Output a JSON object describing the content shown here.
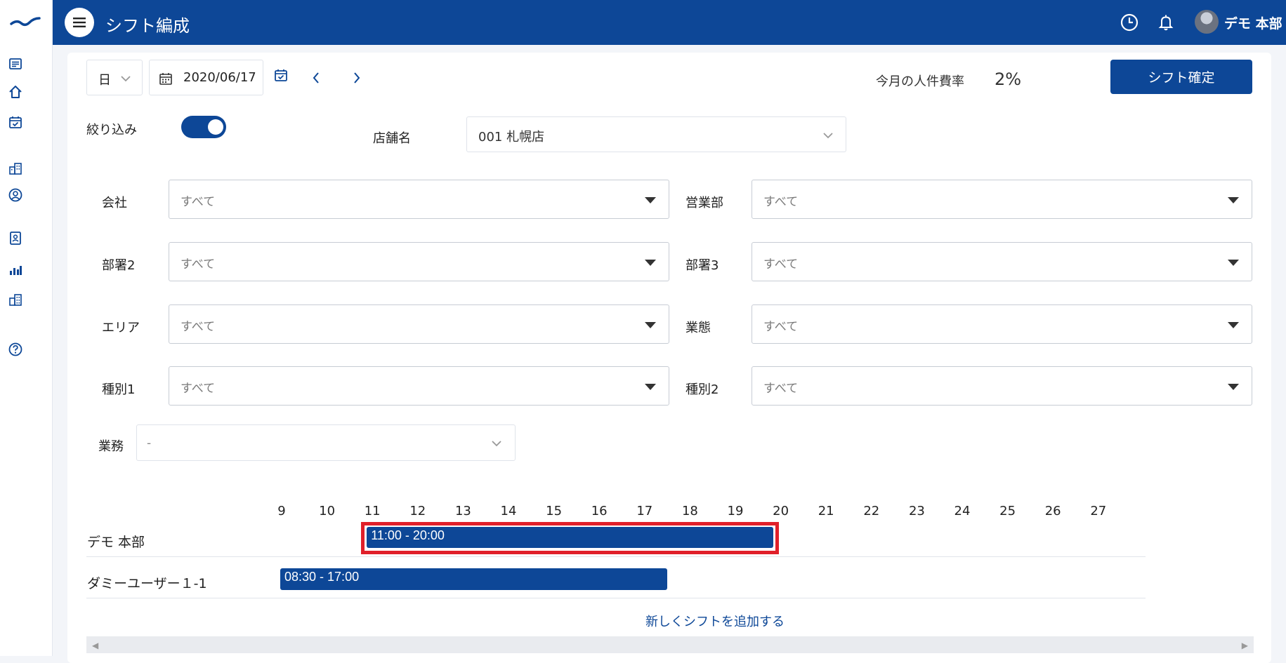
{
  "app": {
    "title": "シフト編成",
    "user": {
      "name": "デモ 本部"
    }
  },
  "toolbar": {
    "view_mode": "日",
    "date": "2020/06/17",
    "labor_cost_label": "今月の人件費率",
    "labor_cost_value": "2%",
    "confirm_button": "シフト確定"
  },
  "filters": {
    "toggle_label": "絞り込み",
    "toggle_on": true,
    "store_label": "店舗名",
    "store_value": "001 札幌店",
    "fields": [
      {
        "label": "会社",
        "value": "すべて"
      },
      {
        "label": "営業部",
        "value": "すべて"
      },
      {
        "label": "部署2",
        "value": "すべて"
      },
      {
        "label": "部署3",
        "value": "すべて"
      },
      {
        "label": "エリア",
        "value": "すべて"
      },
      {
        "label": "業態",
        "value": "すべて"
      },
      {
        "label": "種別1",
        "value": "すべて"
      },
      {
        "label": "種別2",
        "value": "すべて"
      }
    ],
    "task_label": "業務",
    "task_value": "-"
  },
  "timeline": {
    "hours": [
      "9",
      "10",
      "11",
      "12",
      "13",
      "14",
      "15",
      "16",
      "17",
      "18",
      "19",
      "20",
      "21",
      "22",
      "23",
      "24",
      "25",
      "26",
      "27"
    ],
    "rows": [
      {
        "name": "デモ 本部",
        "shift": "11:00 - 20:00",
        "start": 11.0,
        "end": 19.8,
        "highlighted": true
      },
      {
        "name": "ダミーユーザー１-1",
        "shift": "08:30 - 17:00",
        "start": 9.0,
        "end": 17.5,
        "highlighted": false
      }
    ],
    "add_link": "新しくシフトを追加する"
  },
  "colors": {
    "primary": "#0d4797",
    "highlight": "#e0202a",
    "background": "#f3f5f9"
  }
}
